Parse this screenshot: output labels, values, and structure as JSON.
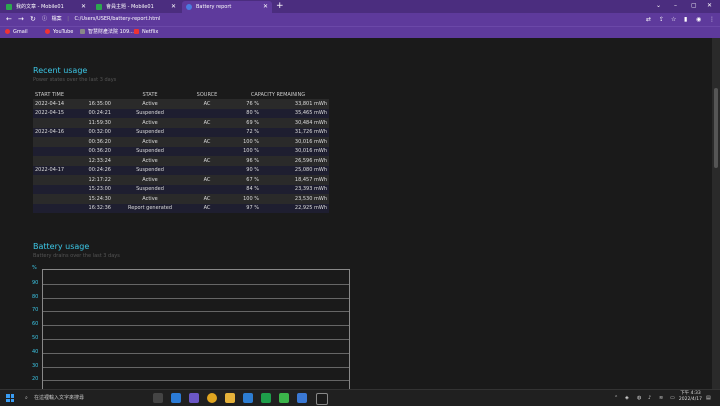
{
  "browser": {
    "tabs": [
      {
        "label": "我的文章 - Mobile01",
        "active": false
      },
      {
        "label": "會員主題 - Mobile01",
        "active": false
      },
      {
        "label": "Battery report",
        "active": true
      }
    ],
    "new_tab": "+",
    "window_controls": [
      "⌄",
      "–",
      "▢",
      "✕"
    ],
    "address_label": "檔案",
    "address": "C:/Users/USER/battery-report.html",
    "bookmarks": [
      "Gmail",
      "YouTube",
      "智慧財產法院 109...",
      "Netflix"
    ]
  },
  "recent_usage": {
    "title": "Recent usage",
    "subtitle": "Power states over the last 3 days",
    "headers": [
      "START TIME",
      "STATE",
      "SOURCE",
      "CAPACITY REMAINING"
    ],
    "rows": [
      {
        "date": "2022-04-14",
        "time": "16:35:00",
        "state": "Active",
        "source": "AC",
        "pct": "76 %",
        "cap": "33,801 mWh"
      },
      {
        "date": "2022-04-15",
        "time": "00:24:21",
        "state": "Suspended",
        "source": "",
        "pct": "80 %",
        "cap": "35,465 mWh"
      },
      {
        "date": "",
        "time": "11:59:30",
        "state": "Active",
        "source": "AC",
        "pct": "69 %",
        "cap": "30,484 mWh"
      },
      {
        "date": "2022-04-16",
        "time": "00:32:00",
        "state": "Suspended",
        "source": "",
        "pct": "72 %",
        "cap": "31,726 mWh"
      },
      {
        "date": "",
        "time": "00:36:20",
        "state": "Active",
        "source": "AC",
        "pct": "100 %",
        "cap": "30,016 mWh"
      },
      {
        "date": "",
        "time": "00:36:20",
        "state": "Suspended",
        "source": "",
        "pct": "100 %",
        "cap": "30,016 mWh"
      },
      {
        "date": "",
        "time": "12:33:24",
        "state": "Active",
        "source": "AC",
        "pct": "96 %",
        "cap": "26,596 mWh"
      },
      {
        "date": "2022-04-17",
        "time": "00:24:26",
        "state": "Suspended",
        "source": "",
        "pct": "90 %",
        "cap": "25,080 mWh"
      },
      {
        "date": "",
        "time": "12:17:22",
        "state": "Active",
        "source": "AC",
        "pct": "67 %",
        "cap": "18,457 mWh"
      },
      {
        "date": "",
        "time": "15:23:00",
        "state": "Suspended",
        "source": "",
        "pct": "84 %",
        "cap": "23,393 mWh"
      },
      {
        "date": "",
        "time": "15:24:30",
        "state": "Active",
        "source": "AC",
        "pct": "100 %",
        "cap": "23,530 mWh"
      },
      {
        "date": "",
        "time": "16:32:36",
        "state": "Report generated",
        "source": "AC",
        "pct": "97 %",
        "cap": "22,925 mWh"
      }
    ]
  },
  "battery_usage": {
    "title": "Battery usage",
    "subtitle": "Battery drains over the last 3 days",
    "y_unit": "%",
    "y_ticks": [
      "90",
      "80",
      "70",
      "60",
      "50",
      "40",
      "30",
      "20"
    ]
  },
  "taskbar": {
    "search_placeholder": "在這裡輸入文字來搜尋",
    "time": "下午 4:33",
    "date": "2022/4/17"
  },
  "colors": {
    "accent": "#3cc7e6",
    "chrome": "#5e3a9c",
    "background": "#1a1a1a"
  }
}
